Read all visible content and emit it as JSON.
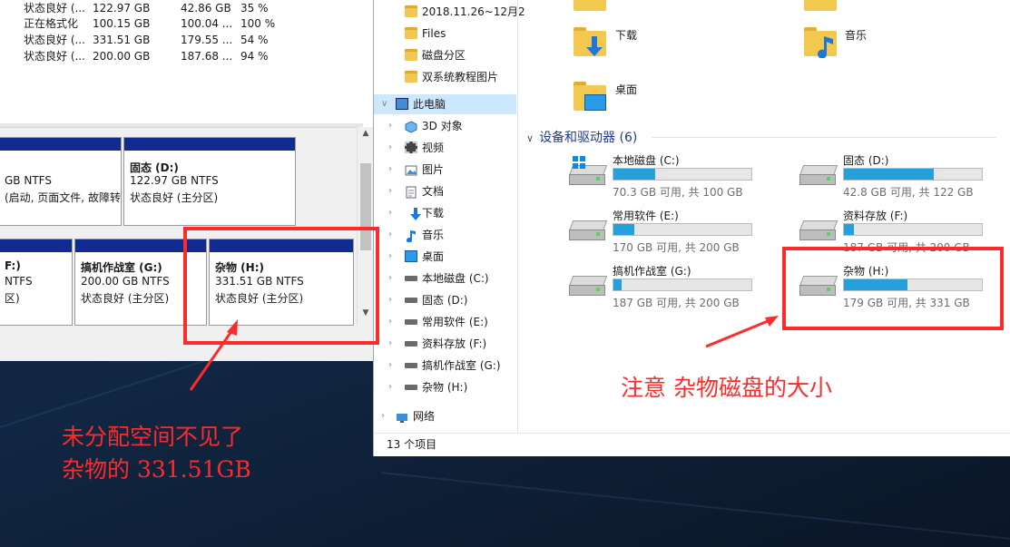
{
  "disk_mgmt": {
    "volumes": [
      {
        "status": "状态良好 (...",
        "capacity": "122.97 GB",
        "free": "42.86 GB",
        "pct": "35 %"
      },
      {
        "status": "正在格式化",
        "capacity": "100.15 GB",
        "free": "100.04 ...",
        "pct": "100 %"
      },
      {
        "status": "状态良好 (...",
        "capacity": "331.51 GB",
        "free": "179.55 ...",
        "pct": "54 %"
      },
      {
        "status": "状态良好 (...",
        "capacity": "200.00 GB",
        "free": "187.68 ...",
        "pct": "94 %"
      }
    ],
    "partitions_row1": [
      {
        "line1": "GB NTFS",
        "line2": "(启动, 页面文件, 故障转"
      },
      {
        "name": "固态 (D:)",
        "line1": "122.97 GB NTFS",
        "line2": "状态良好 (主分区)"
      }
    ],
    "partitions_row2": [
      {
        "name": "F:)",
        "line1": "NTFS",
        "line2": "区)"
      },
      {
        "name": "搞机作战室 (G:)",
        "line1": "200.00 GB NTFS",
        "line2": "状态良好 (主分区)"
      },
      {
        "name": "杂物 (H:)",
        "line1": "331.51 GB NTFS",
        "line2": "状态良好 (主分区)"
      }
    ]
  },
  "explorer": {
    "nav_items": [
      {
        "label": "2018.11.26~12月2",
        "icon": "folder-icon"
      },
      {
        "label": "Files",
        "icon": "folder-icon"
      },
      {
        "label": "磁盘分区",
        "icon": "folder-icon"
      },
      {
        "label": "双系统教程图片",
        "icon": "folder-icon"
      },
      {
        "label": "此电脑",
        "icon": "computer-icon",
        "selected": true
      },
      {
        "label": "3D 对象",
        "icon": "3d-objects-icon"
      },
      {
        "label": "视频",
        "icon": "video-icon"
      },
      {
        "label": "图片",
        "icon": "pictures-icon"
      },
      {
        "label": "文档",
        "icon": "documents-icon"
      },
      {
        "label": "下载",
        "icon": "download-icon"
      },
      {
        "label": "音乐",
        "icon": "music-icon"
      },
      {
        "label": "桌面",
        "icon": "desktop-icon"
      },
      {
        "label": "本地磁盘 (C:)",
        "icon": "drive-icon"
      },
      {
        "label": "固态 (D:)",
        "icon": "drive-icon"
      },
      {
        "label": "常用软件 (E:)",
        "icon": "drive-icon"
      },
      {
        "label": "资料存放 (F:)",
        "icon": "drive-icon"
      },
      {
        "label": "搞机作战室 (G:)",
        "icon": "drive-icon"
      },
      {
        "label": "杂物 (H:)",
        "icon": "drive-icon"
      },
      {
        "label": "网络",
        "icon": "network-icon"
      }
    ],
    "status_text": "13 个项目",
    "folders": [
      {
        "label": "下载",
        "icon": "download-folder-icon"
      },
      {
        "label": "音乐",
        "icon": "music-folder-icon"
      },
      {
        "label": "桌面",
        "icon": "desktop-folder-icon"
      }
    ],
    "devices_group_label": "设备和驱动器 (6)",
    "drives": [
      {
        "name": "本地磁盘 (C:)",
        "info": "70.3 GB 可用, 共 100 GB",
        "used_fraction": 0.3,
        "windows": true
      },
      {
        "name": "固态 (D:)",
        "info": "42.8 GB 可用, 共 122 GB",
        "used_fraction": 0.65
      },
      {
        "name": "常用软件 (E:)",
        "info": "170 GB 可用, 共 200 GB",
        "used_fraction": 0.15
      },
      {
        "name": "资料存放 (F:)",
        "info": "187 GB 可用, 共 200 GB",
        "used_fraction": 0.07
      },
      {
        "name": "搞机作战室 (G:)",
        "info": "187 GB 可用, 共 200 GB",
        "used_fraction": 0.06
      },
      {
        "name": "杂物 (H:)",
        "info": "179 GB 可用, 共 331 GB",
        "used_fraction": 0.46
      }
    ]
  },
  "annotations": {
    "note_right": "注意  杂物磁盘的大小",
    "note_left_line1": "未分配空间不见了",
    "note_left_line2": "杂物的 331.51GB",
    "color": "#ff2a2a"
  }
}
